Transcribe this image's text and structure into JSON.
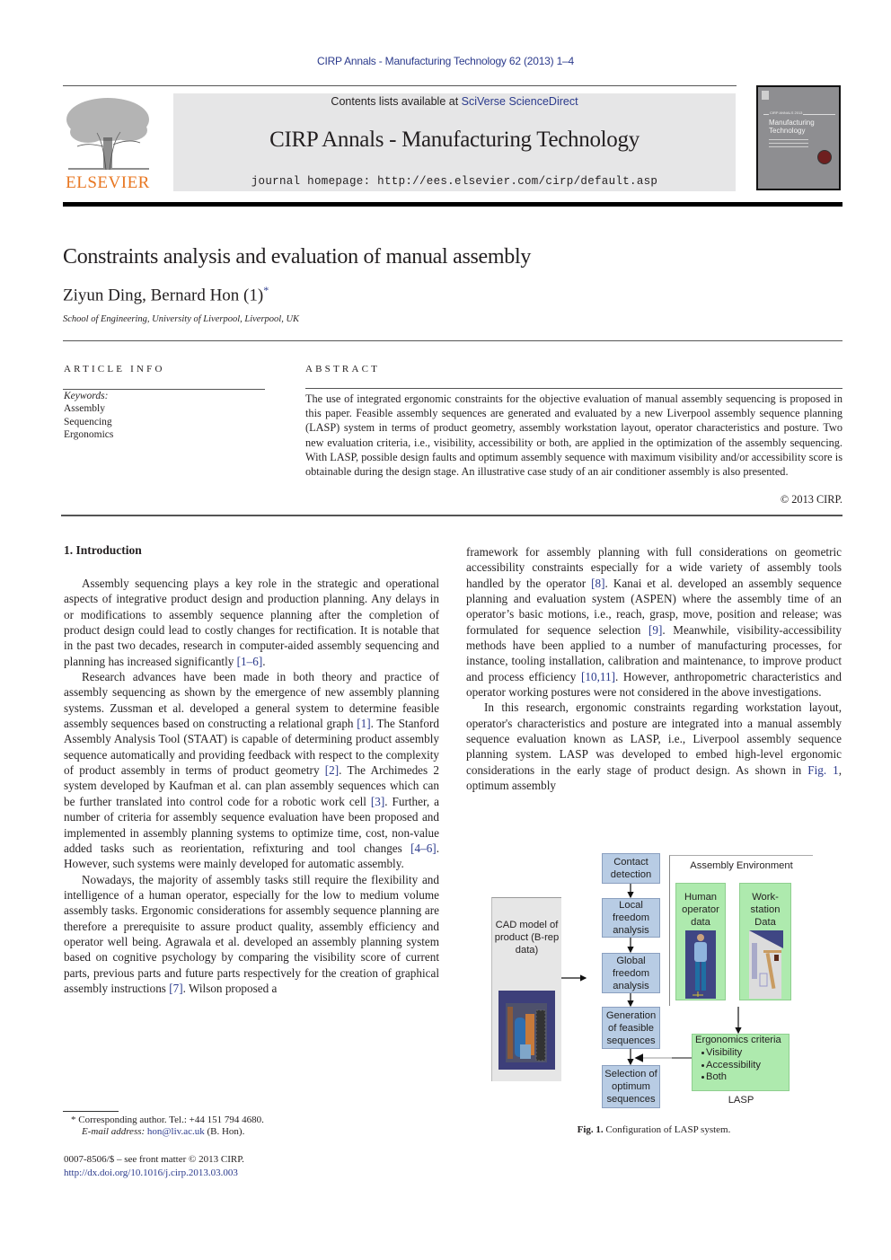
{
  "running_head": "CIRP Annals - Manufacturing Technology 62 (2013) 1–4",
  "publisher": {
    "logo_text": "ELSEVIER"
  },
  "banner": {
    "contents_prefix": "Contents lists available at ",
    "contents_link": "SciVerse ScienceDirect",
    "journal_title": "CIRP Annals - Manufacturing Technology",
    "homepage_label": "journal homepage: ",
    "homepage_url": "http://ees.elsevier.com/cirp/default.asp"
  },
  "cover": {
    "series": "CIRP ANNALS 2013",
    "title_line1": "Manufacturing",
    "title_line2": "Technology"
  },
  "article": {
    "title": "Constraints analysis and evaluation of manual assembly",
    "authors": "Ziyun Ding, Bernard Hon (1)",
    "author_mark": "*",
    "affiliation": "School of Engineering, University of Liverpool, Liverpool, UK"
  },
  "article_info": {
    "heading": "ARTICLE INFO",
    "keywords_label": "Keywords:",
    "keywords": [
      "Assembly",
      "Sequencing",
      "Ergonomics"
    ]
  },
  "abstract": {
    "heading": "ABSTRACT",
    "text": "The use of integrated ergonomic constraints for the objective evaluation of manual assembly sequencing is proposed in this paper. Feasible assembly sequences are generated and evaluated by a new Liverpool assembly sequence planning (LASP) system in terms of product geometry, assembly workstation layout, operator characteristics and posture. Two new evaluation criteria, i.e., visibility, accessibility or both, are applied in the optimization of the assembly sequencing. With LASP, possible design faults and optimum assembly sequence with maximum visibility and/or accessibility score is obtainable during the design stage. An illustrative case study of an air conditioner assembly is also presented.",
    "copyright": "© 2013 CIRP."
  },
  "section1": {
    "heading": "1.  Introduction",
    "left_paragraphs": [
      [
        {
          "t": "Assembly sequencing plays a key role in the strategic and operational aspects of integrative product design and production planning. Any delays in or modifications to assembly sequence planning after the completion of product design could lead to costly changes for rectification. It is notable that in the past two decades, research in computer-aided assembly sequencing and planning has increased significantly "
        },
        {
          "t": "[1–6]",
          "link": true
        },
        {
          "t": "."
        }
      ],
      [
        {
          "t": "Research advances have been made in both theory and practice of assembly sequencing as shown by the emergence of new assembly planning systems. Zussman et al. developed a general system to determine feasible assembly sequences based on constructing a relational graph "
        },
        {
          "t": "[1]",
          "link": true
        },
        {
          "t": ". The Stanford Assembly Analysis Tool (STAAT) is capable of determining product assembly sequence automatically and providing feedback with respect to the complexity of product assembly in terms of product geometry "
        },
        {
          "t": "[2]",
          "link": true
        },
        {
          "t": ". The Archimedes 2 system developed by Kaufman et al. can plan assembly sequences which can be further translated into control code for a robotic work cell "
        },
        {
          "t": "[3]",
          "link": true
        },
        {
          "t": ". Further, a number of criteria for assembly sequence evaluation have been proposed and imple­mented in assembly planning systems to optimize time, cost, non-value added tasks such as reorientation, refixturing and tool changes "
        },
        {
          "t": "[4–6]",
          "link": true
        },
        {
          "t": ". However, such systems were mainly developed for automatic assembly."
        }
      ],
      [
        {
          "t": "Nowadays, the majority of assembly tasks still require the flexibility and intelligence of a human operator, especially for the low to medium volume assembly tasks. Ergonomic considerations for assembly sequence planning are therefore a prerequisite to assure product quality, assembly efficiency and operator well being. Agrawala et al. developed an assembly planning system based on cognitive psychology by comparing the visibility score of current parts, previous parts and future parts respectively for the creation of graphical assembly instructions "
        },
        {
          "t": "[7]",
          "link": true
        },
        {
          "t": ". Wilson proposed a"
        }
      ]
    ],
    "right_paragraphs": [
      [
        {
          "t": "framework for assembly planning with full considerations on geometric accessibility constraints especially for a wide variety of assembly tools handled by the operator "
        },
        {
          "t": "[8]",
          "link": true
        },
        {
          "t": ". Kanai et al. developed an assembly sequence planning and evaluation system (ASPEN) where the assembly time of an operator’s basic motions, i.e., reach, grasp, move, position and release; was formulated for sequence selection "
        },
        {
          "t": "[9]",
          "link": true
        },
        {
          "t": ". Meanwhile, visibility-accessibility methods have been applied to a number of manufacturing processes, for instance, tooling installation, calibration and maintenance, to improve product and process efficiency "
        },
        {
          "t": "[10,11]",
          "link": true
        },
        {
          "t": ". However, anthropometric characteristics and operator working postures were not considered in the above investigations."
        }
      ],
      [
        {
          "t": "In this research, ergonomic constraints regarding workstation layout, operator's characteristics and posture are integrated into a manual assembly sequence evaluation known as LASP, i.e., Liverpool assembly sequence planning system. LASP was devel­oped to embed high-level ergonomic considerations in the early stage of product design. As shown in "
        },
        {
          "t": "Fig. 1",
          "link": true
        },
        {
          "t": ", optimum assembly"
        }
      ]
    ]
  },
  "figure1": {
    "cad_box": "CAD model of product (B-rep data)",
    "flow_steps": [
      "Contact detection",
      "Local freedom analysis",
      "Global freedom analysis",
      "Generation of feasible sequences",
      "Selection of optimum sequences"
    ],
    "environment_title": "Assembly Environment",
    "environment_boxes": [
      "Human operator data",
      "Work-station Data"
    ],
    "criteria_title": "Ergonomics criteria",
    "criteria_items": [
      "Visibility",
      "Accessibility",
      "Both"
    ],
    "system_label": "LASP",
    "caption_label": "Fig. 1.",
    "caption_text": " Configuration of LASP system."
  },
  "footnotes": {
    "corresponding": "* Corresponding author. Tel.: +44 151 794 4680.",
    "email_label": "E-mail address: ",
    "email": "hon@liv.ac.uk",
    "email_suffix": " (B. Hon).",
    "front_matter": "0007-8506/$ – see front matter © 2013 CIRP.",
    "doi": "http://dx.doi.org/10.1016/j.cirp.2013.03.003"
  }
}
